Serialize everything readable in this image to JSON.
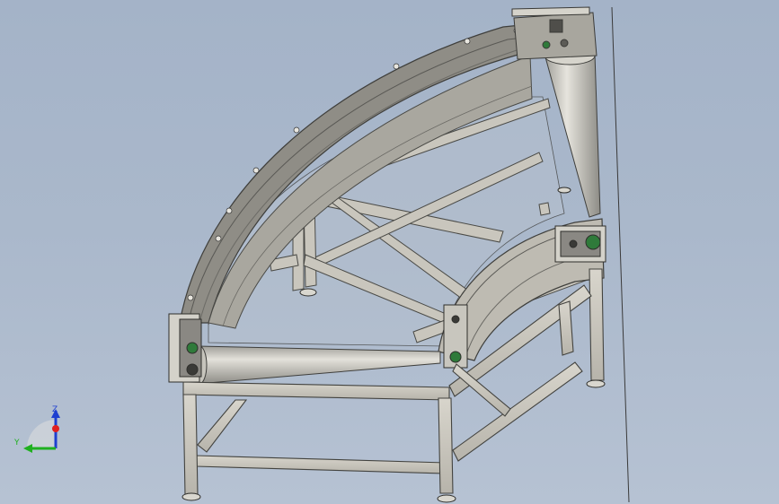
{
  "viewport": {
    "background_top": "#a4b3c8",
    "background_bottom": "#b6c2d3"
  },
  "model": {
    "frame_color": "#c9c6bd",
    "frame_edge": "#4a4a46",
    "guard_color": "#9c9a92",
    "glass_color": "#b8c1cd"
  },
  "triad": {
    "y_label": "Y",
    "z_label": "Z",
    "x_color": "#e02020",
    "y_color": "#1fb01f",
    "z_color": "#1f3fd0"
  }
}
